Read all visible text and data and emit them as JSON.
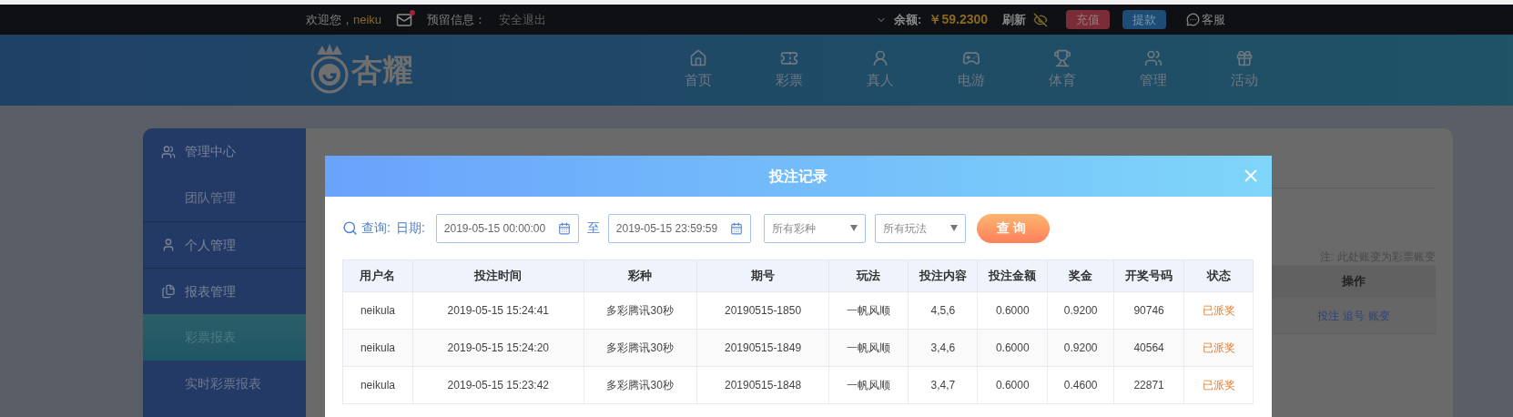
{
  "top_bar": {
    "greeting": "欢迎您，",
    "username": "neiku",
    "mail_unread": true,
    "reserved_info": "预留信息：",
    "logout": "安全退出",
    "balance_label": "余额:",
    "balance": "￥59.2300",
    "refresh": "刷新",
    "deposit": "充值",
    "withdraw": "提款",
    "support": "客服"
  },
  "header": {
    "logo_text": "杏耀",
    "nav": [
      {
        "label": "首页",
        "kind": "home"
      },
      {
        "label": "彩票",
        "kind": "lottery"
      },
      {
        "label": "真人",
        "kind": "live"
      },
      {
        "label": "电游",
        "kind": "slots"
      },
      {
        "label": "体育",
        "kind": "sports"
      },
      {
        "label": "管理",
        "kind": "manage"
      },
      {
        "label": "活动",
        "kind": "events"
      }
    ]
  },
  "sidebar": {
    "sections": [
      {
        "title": "管理中心",
        "kind": "team",
        "items": [
          {
            "label": "团队管理",
            "selected": false
          }
        ]
      },
      {
        "title": "个人管理",
        "kind": "person"
      },
      {
        "title": "报表管理",
        "kind": "report",
        "items": [
          {
            "label": "彩票报表",
            "selected": true
          },
          {
            "label": "实时彩票报表",
            "selected": false
          }
        ]
      }
    ]
  },
  "content": {
    "note": "注: 此处账变为彩票账变",
    "table": {
      "columns": [
        "操作"
      ],
      "rows": [
        {
          "actions": [
            "投注",
            "追号",
            "账变"
          ]
        }
      ]
    }
  },
  "modal": {
    "title": "投注记录",
    "query_label": "查询:",
    "date_label": "日期:",
    "start_date": "2019-05-15 00:00:00",
    "separator": "至",
    "end_date": "2019-05-15 23:59:59",
    "lottery_select": "所有彩种",
    "play_select": "所有玩法",
    "submit": "查询",
    "table": {
      "columns": [
        "用户名",
        "投注时间",
        "彩种",
        "期号",
        "玩法",
        "投注内容",
        "投注金额",
        "奖金",
        "开奖号码",
        "状态"
      ],
      "rows": [
        [
          "neikula",
          "2019-05-15 15:24:41",
          "多彩腾讯30秒",
          "20190515-1850",
          "一帆风顺",
          "4,5,6",
          "0.6000",
          "0.9200",
          "90746",
          "已派奖"
        ],
        [
          "neikula",
          "2019-05-15 15:24:20",
          "多彩腾讯30秒",
          "20190515-1849",
          "一帆风顺",
          "3,4,6",
          "0.6000",
          "0.9200",
          "40564",
          "已派奖"
        ],
        [
          "neikula",
          "2019-05-15 15:23:42",
          "多彩腾讯30秒",
          "20190515-1848",
          "一帆风顺",
          "3,4,7",
          "0.6000",
          "0.4600",
          "22871",
          "已派奖"
        ]
      ]
    }
  }
}
